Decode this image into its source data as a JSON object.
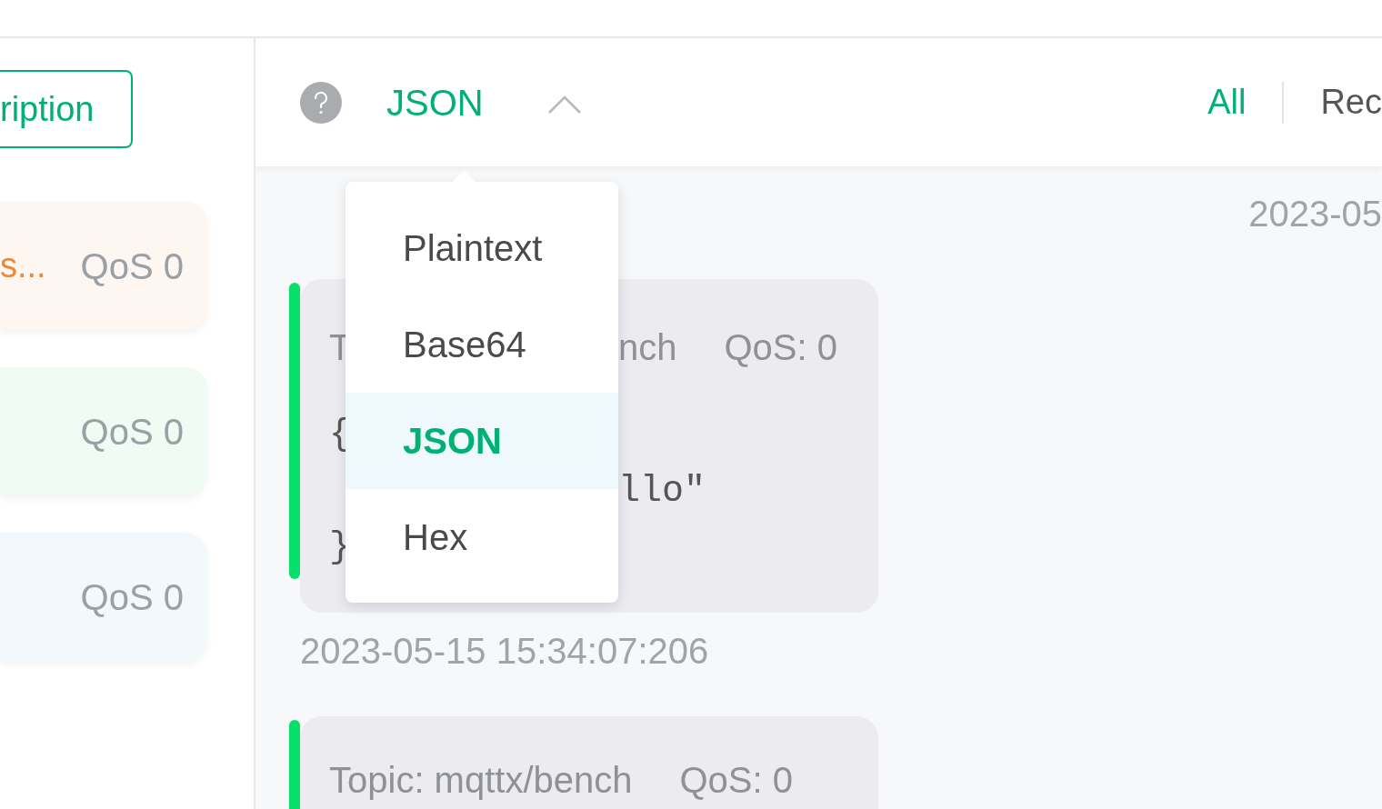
{
  "sidebar": {
    "new_subscription_button": "ription",
    "subscriptions": [
      {
        "topic": "s...",
        "qos": "QoS 0",
        "color": "#fdf6f1"
      },
      {
        "qos": "QoS 0",
        "color": "#f0fbf3"
      },
      {
        "qos": "QoS 0",
        "color": "#f1f9fc"
      }
    ]
  },
  "header": {
    "payload_format": "JSON",
    "expanded": true,
    "filters": [
      {
        "label": "All",
        "selected": true
      },
      {
        "label": "Rec",
        "selected": false
      }
    ]
  },
  "payload_menu": {
    "items": [
      {
        "label": "Plaintext",
        "selected": false
      },
      {
        "label": "Base64",
        "selected": false
      },
      {
        "label": "JSON",
        "selected": true
      },
      {
        "label": "Hex",
        "selected": false
      }
    ]
  },
  "messages": [
    {
      "kind": "time",
      "time": "2023-05"
    },
    {
      "kind": "card",
      "topic_left": "T",
      "topic_right": "nch",
      "qos": "QoS: 0",
      "payload_lines": [
        {
          "left": "{"
        },
        {
          "right": "llo\""
        },
        {
          "left": "}"
        }
      ],
      "time": "2023-05-15 15:34:07:206"
    },
    {
      "kind": "card",
      "topic_left": "Topic: mqttx/bench",
      "qos": "QoS: 0"
    }
  ]
}
